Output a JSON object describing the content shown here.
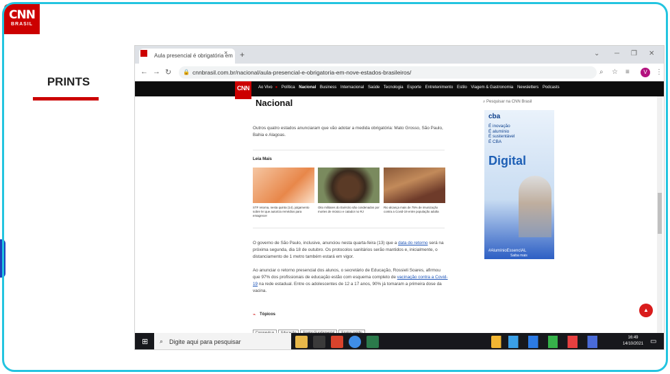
{
  "slide": {
    "logo_big": "CNN",
    "logo_small": "BRASIL",
    "title": "PRINTS"
  },
  "browser": {
    "tab_title": "Aula presencial é obrigatória em",
    "tab_close": "×",
    "new_tab": "+",
    "url": "cnnbrasil.com.br/nacional/aula-presencial-e-obrigatoria-em-nove-estados-brasileiros/",
    "profile_initial": "V"
  },
  "site": {
    "logo": "CNN",
    "nav": [
      "Ao Vivo",
      "Política",
      "Nacional",
      "Business",
      "Internacional",
      "Saúde",
      "Tecnologia",
      "Esporte",
      "Entretenimento",
      "Estilo",
      "Viagem & Gastronomia",
      "Newsletters",
      "Podcasts"
    ],
    "section_title": "Nacional",
    "search_placeholder": "Pesquisar na CNN Brasil"
  },
  "article": {
    "para1": "Outros quatro estados anunciaram que vão adotar a medida obrigatória: Mato Grosso, São Paulo, Bahia e Alagoas.",
    "leia_mais": "Leia Mais",
    "related": [
      {
        "caption": "STF retoma, nesta quinta (14), julgamento sobre lei que autoriza remédios para emagrecer"
      },
      {
        "caption": "Oito militares do Exército são condenados por mortes de músico e catador no RJ"
      },
      {
        "caption": "Rio alcança mais de 75% de imunização contra a Covid-19 entre população adulta"
      }
    ],
    "para2_a": "O governo de São Paulo, inclusive, anunciou nesta quarta-feira (13) que a ",
    "para2_link": "data do retorno",
    "para2_b": " será na próxima segunda, dia 18 de outubro. Os protocolos sanitários serão mantidos e, inicialmente, o distanciamento de 1 metro também estará em vigor.",
    "para3_a": "Ao anunciar o retorno presencial dos alunos, o secretário de Educação, Rossieli Soares, afirmou que 97% dos profissionais de educação estão com esquema completo de ",
    "para3_link": "vacinação contra a Covid-19",
    "para3_b": " na rede estadual. Entre os adolescentes de 12 a 17 anos, 90% já tomaram a primeira dose da vacina.",
    "topicos": "Tópicos",
    "tags": [
      "Coronavírus",
      "Educação",
      "Ensino Fundamental",
      "Ensino médio"
    ]
  },
  "ad": {
    "brand": "cba",
    "lines": "É inovação\nÉ alumínio\nÉ sustentável\nÉ CBA",
    "headline": "Digital",
    "hashtag": "#AlumínioEssencIAL",
    "cta": "Saiba mais"
  },
  "taskbar": {
    "search_placeholder": "Digite aqui para pesquisar",
    "time": "16:49",
    "date": "14/10/2021"
  },
  "colors": {
    "cnn_red": "#cc0000",
    "frame_cyan": "#22c4e0",
    "link_blue": "#1a52b7"
  }
}
